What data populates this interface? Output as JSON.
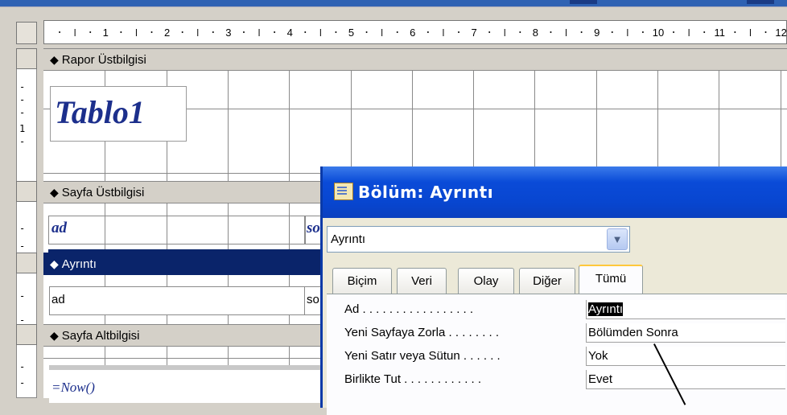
{
  "ruler": {
    "numbers": [
      "1",
      "2",
      "3",
      "4",
      "5",
      "6",
      "7",
      "8",
      "9",
      "10",
      "11",
      "12"
    ]
  },
  "vertical_ruler": {
    "marks": [
      "-",
      "-",
      "-",
      "1",
      "-",
      "-",
      "-",
      "-",
      "-",
      "-",
      "-",
      "-",
      "-"
    ]
  },
  "sections": {
    "report_header": "Rapor Üstbilgisi",
    "page_header": "Sayfa Üstbilgisi",
    "detail": "Ayrıntı",
    "page_footer": "Sayfa Altbilgisi"
  },
  "controls": {
    "title": "Tablo1",
    "header_ad": "ad",
    "header_so": "so",
    "detail_ad": "ad",
    "detail_so": "so",
    "now": "=Now()"
  },
  "dialog": {
    "title": "Bölüm: Ayrıntı",
    "combo_value": "Ayrıntı",
    "combo_arrow": "chevron-down-icon",
    "tabs": [
      {
        "label": "Biçim"
      },
      {
        "label": "Veri"
      },
      {
        "label": "Olay"
      },
      {
        "label": "Diğer"
      },
      {
        "label": "Tümü"
      }
    ],
    "properties": [
      {
        "name": "Ad . . . . . . . . . . . . . . . . .",
        "value": "Ayrıntı"
      },
      {
        "name": "Yeni Sayfaya Zorla . . . . . . . .",
        "value": "Bölümden Sonra"
      },
      {
        "name": "Yeni Satır veya Sütun . . . . . .",
        "value": "Yok"
      },
      {
        "name": "Birlikte Tut . . . . . . . . . . . .",
        "value": "Evet"
      }
    ]
  },
  "colors": {
    "selection": "#0a246a",
    "title_bar": "#0a4bd8",
    "label_text": "#1c2f8c"
  }
}
